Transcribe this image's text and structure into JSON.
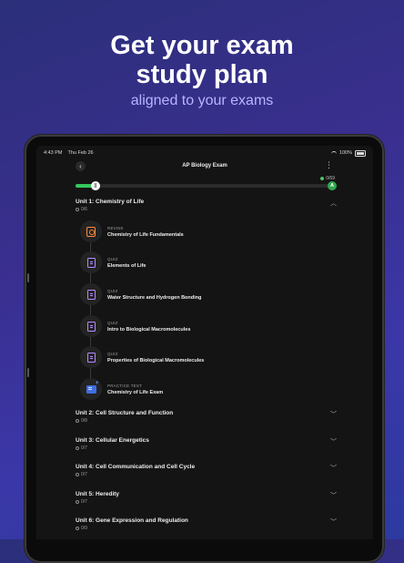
{
  "marketing": {
    "headline_line1": "Get your exam",
    "headline_line2": "study plan",
    "subheadline": "aligned to your exams"
  },
  "status_bar": {
    "time": "4:43 PM",
    "date": "Thu Feb 26",
    "battery": "100%"
  },
  "header": {
    "title": "AP Biology Exam",
    "back_icon": "chevron-left-icon",
    "menu_icon": "vertical-ellipsis-icon"
  },
  "progress": {
    "count": "0/69",
    "knob_label": "||",
    "grade": "A",
    "fraction": 0.06
  },
  "units": [
    {
      "title": "Unit 1: Chemistry of Life",
      "progress": "0/6",
      "expanded": true,
      "steps": [
        {
          "kind": "REVISE",
          "name": "Chemistry of Life Fundamentals",
          "icon": "revise-icon"
        },
        {
          "kind": "QUIZ",
          "name": "Elements of Life",
          "icon": "quiz-doc-icon"
        },
        {
          "kind": "QUIZ",
          "name": "Water Structure and Hydrogen Bonding",
          "icon": "quiz-doc-icon"
        },
        {
          "kind": "QUIZ",
          "name": "Intro to Biological Macromolecules",
          "icon": "quiz-doc-icon"
        },
        {
          "kind": "QUIZ",
          "name": "Properties of Biological Macromolecules",
          "icon": "quiz-doc-icon"
        },
        {
          "kind": "PRACTICE TEST",
          "name": "Chemistry of Life Exam",
          "icon": "practice-test-icon"
        }
      ]
    },
    {
      "title": "Unit 2: Cell Structure and Function",
      "progress": "0/8"
    },
    {
      "title": "Unit 3: Cellular Energetics",
      "progress": "0/7"
    },
    {
      "title": "Unit 4: Cell Communication and Cell Cycle",
      "progress": "0/7"
    },
    {
      "title": "Unit 5: Heredity",
      "progress": "0/7"
    },
    {
      "title": "Unit 6: Gene Expression and Regulation",
      "progress": "0/9"
    }
  ]
}
